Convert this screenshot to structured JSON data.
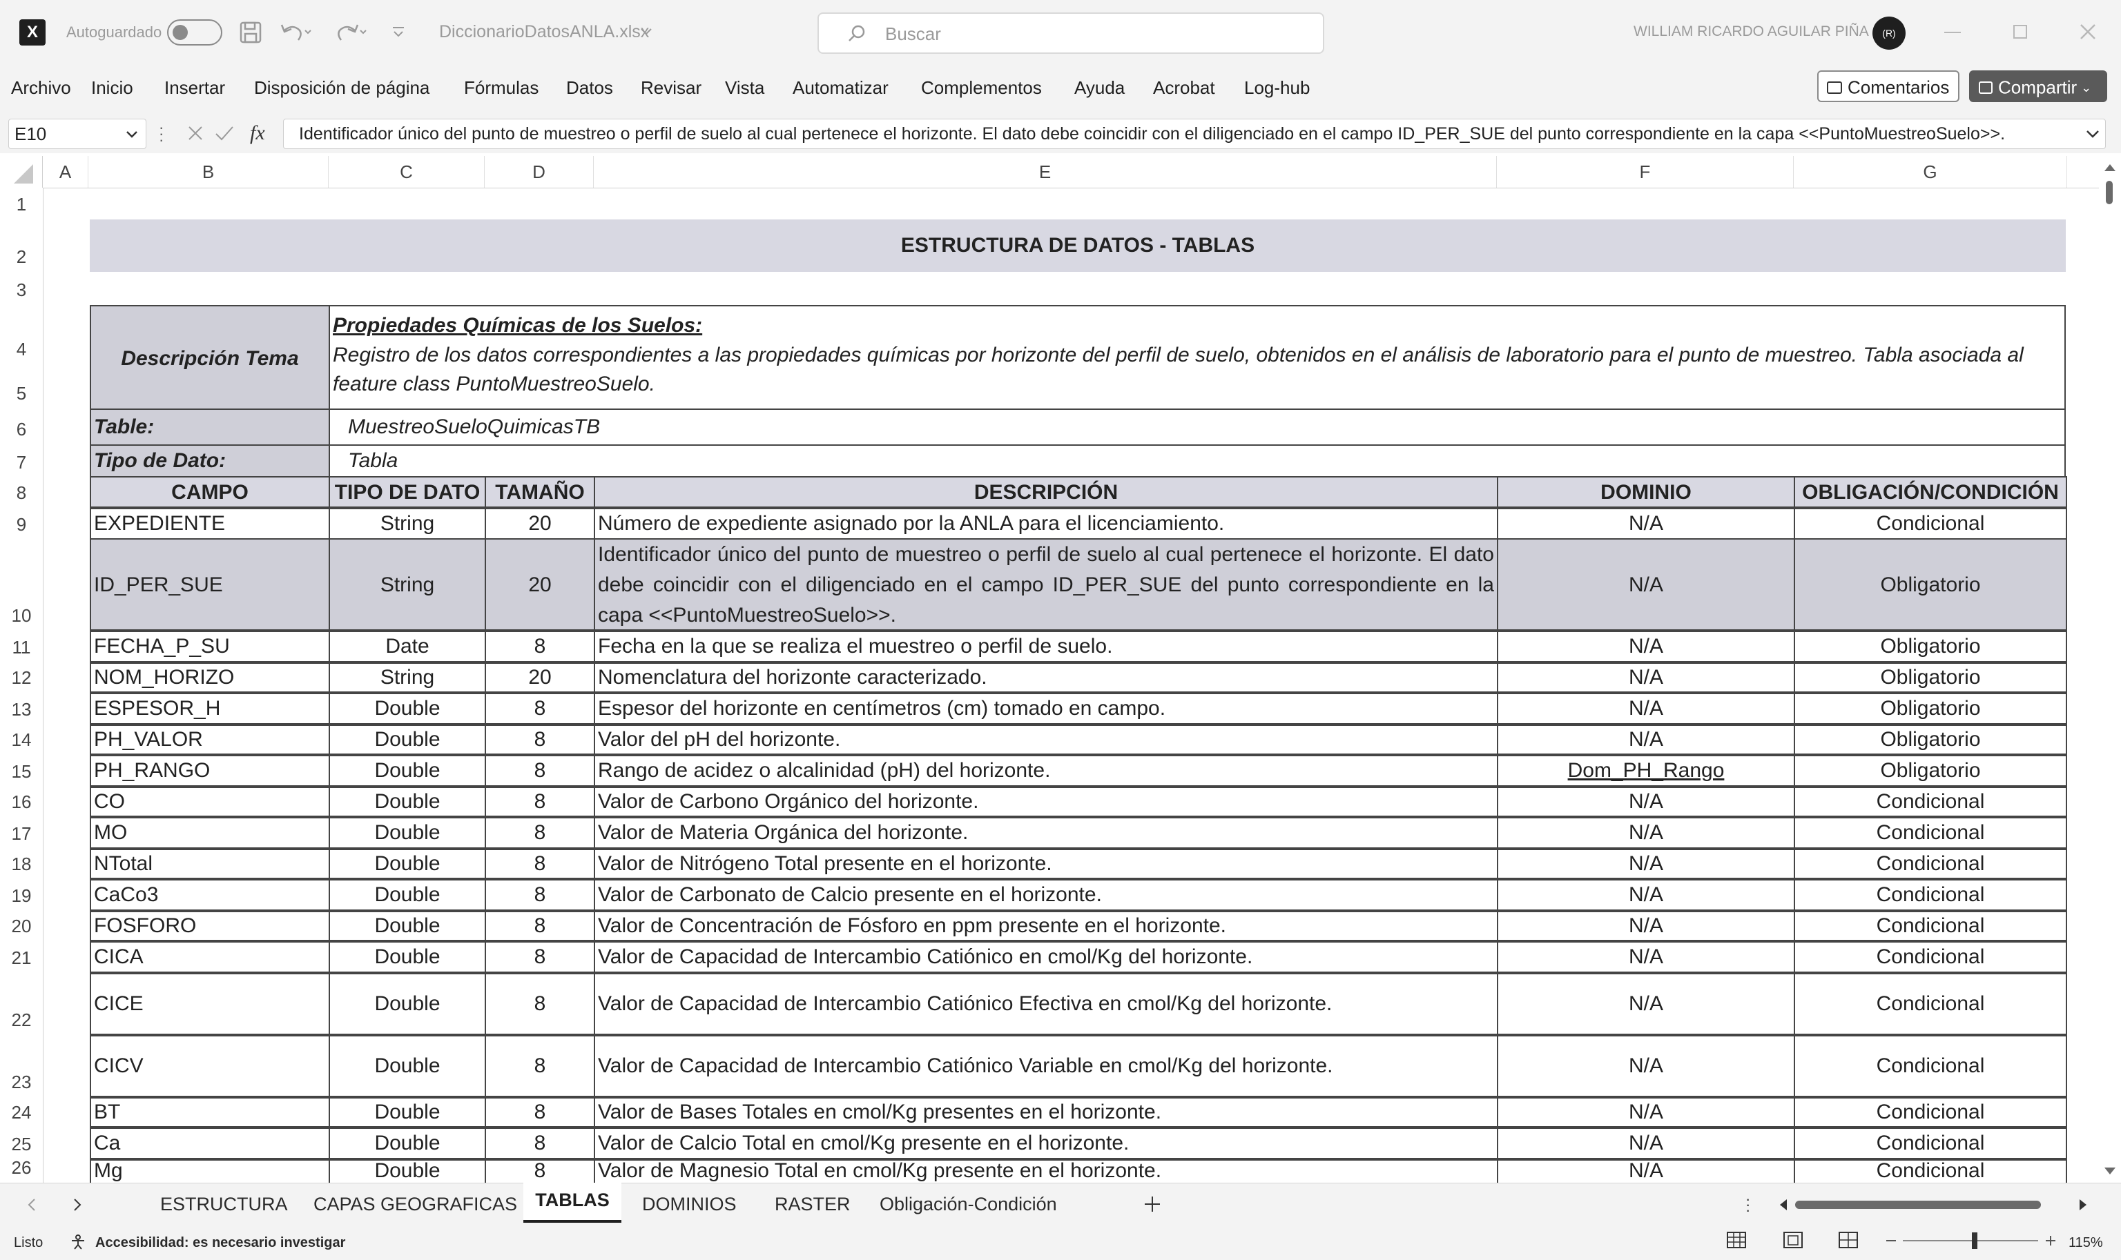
{
  "app": {
    "autosave_label": "Autoguardado",
    "file_name": "DiccionarioDatosANLA.xlsx",
    "search_placeholder": "Buscar",
    "user_name": "WILLIAM RICARDO AGUILAR PIÑA",
    "user_initials": "(R)"
  },
  "menu": [
    "Archivo",
    "Inicio",
    "Insertar",
    "Disposición de página",
    "Fórmulas",
    "Datos",
    "Revisar",
    "Vista",
    "Automatizar",
    "Complementos",
    "Ayuda",
    "Acrobat",
    "Log-hub"
  ],
  "ribbon_buttons": {
    "comments": "Comentarios",
    "share": "Compartir"
  },
  "formula_bar": {
    "name_box": "E10",
    "fx": "fx",
    "content": "Identificador único del punto de muestreo o perfil de suelo al cual pertenece el horizonte. El dato debe coincidir con el diligenciado en el campo ID_PER_SUE del punto correspondiente en la capa <<PuntoMuestreoSuelo>>."
  },
  "columns": [
    "A",
    "B",
    "C",
    "D",
    "E",
    "F",
    "G"
  ],
  "rows": [
    "1",
    "2",
    "3",
    "4",
    "5",
    "6",
    "7",
    "8",
    "9",
    "10",
    "11",
    "12",
    "13",
    "14",
    "15",
    "16",
    "17",
    "18",
    "19",
    "20",
    "21",
    "22",
    "23",
    "24",
    "25",
    "26"
  ],
  "sheet": {
    "title": "ESTRUCTURA DE DATOS - TABLAS",
    "desc_label": "Descripción Tema",
    "topic_title": "Propiedades Químicas de los Suelos:",
    "topic_description": "Registro de los datos correspondientes a las propiedades químicas por horizonte del perfil de suelo, obtenidos en el análisis de laboratorio para el punto de muestreo. Tabla asociada al feature class PuntoMuestreoSuelo.",
    "table_label": "Table:",
    "table_value": "MuestreoSueloQuimicasTB",
    "type_label": "Tipo de Dato:",
    "type_value": "Tabla",
    "headers": [
      "CAMPO",
      "TIPO DE DATO",
      "TAMAÑO",
      "DESCRIPCIÓN",
      "DOMINIO",
      "OBLIGACIÓN/CONDICIÓN"
    ],
    "records": [
      {
        "campo": "EXPEDIENTE",
        "tipo": "String",
        "tam": "20",
        "desc": "Número de expediente asignado por la ANLA para el licenciamiento.",
        "dom": "N/A",
        "obl": "Condicional"
      },
      {
        "campo": "ID_PER_SUE",
        "tipo": "String",
        "tam": "20",
        "desc": "Identificador único del punto de muestreo o perfil de suelo al cual pertenece el horizonte. El dato debe coincidir con el diligenciado en el campo ID_PER_SUE del punto correspondiente en la capa <<PuntoMuestreoSuelo>>.",
        "dom": "N/A",
        "obl": "Obligatorio"
      },
      {
        "campo": "FECHA_P_SU",
        "tipo": "Date",
        "tam": "8",
        "desc": "Fecha en la que se realiza el muestreo o perfil de suelo.",
        "dom": "N/A",
        "obl": "Obligatorio"
      },
      {
        "campo": "NOM_HORIZO",
        "tipo": "String",
        "tam": "20",
        "desc": "Nomenclatura del horizonte caracterizado.",
        "dom": "N/A",
        "obl": "Obligatorio"
      },
      {
        "campo": "ESPESOR_H",
        "tipo": "Double",
        "tam": "8",
        "desc": "Espesor del horizonte en centímetros (cm) tomado en campo.",
        "dom": "N/A",
        "obl": "Obligatorio"
      },
      {
        "campo": "PH_VALOR",
        "tipo": "Double",
        "tam": "8",
        "desc": "Valor del pH del horizonte.",
        "dom": "N/A",
        "obl": "Obligatorio"
      },
      {
        "campo": "PH_RANGO",
        "tipo": "Double",
        "tam": "8",
        "desc": "Rango de acidez o alcalinidad (pH) del horizonte.",
        "dom": "Dom_PH_Rango",
        "obl": "Obligatorio"
      },
      {
        "campo": "CO",
        "tipo": "Double",
        "tam": "8",
        "desc": "Valor de Carbono Orgánico del horizonte.",
        "dom": "N/A",
        "obl": "Condicional"
      },
      {
        "campo": "MO",
        "tipo": "Double",
        "tam": "8",
        "desc": "Valor de Materia Orgánica del horizonte.",
        "dom": "N/A",
        "obl": "Condicional"
      },
      {
        "campo": "NTotal",
        "tipo": "Double",
        "tam": "8",
        "desc": "Valor de Nitrógeno Total presente en el horizonte.",
        "dom": "N/A",
        "obl": "Condicional"
      },
      {
        "campo": "CaCo3",
        "tipo": "Double",
        "tam": "8",
        "desc": "Valor de Carbonato de Calcio presente en el horizonte.",
        "dom": "N/A",
        "obl": "Condicional"
      },
      {
        "campo": "FOSFORO",
        "tipo": "Double",
        "tam": "8",
        "desc": "Valor de Concentración de Fósforo en ppm presente en el horizonte.",
        "dom": "N/A",
        "obl": "Condicional"
      },
      {
        "campo": "CICA",
        "tipo": "Double",
        "tam": "8",
        "desc": "Valor de Capacidad de Intercambio Catiónico en cmol/Kg del horizonte.",
        "dom": "N/A",
        "obl": "Condicional"
      },
      {
        "campo": "CICE",
        "tipo": "Double",
        "tam": "8",
        "desc": "Valor de Capacidad de Intercambio Catiónico Efectiva en cmol/Kg del horizonte.",
        "dom": "N/A",
        "obl": "Condicional"
      },
      {
        "campo": "CICV",
        "tipo": "Double",
        "tam": "8",
        "desc": "Valor de Capacidad de Intercambio Catiónico Variable en cmol/Kg del horizonte.",
        "dom": "N/A",
        "obl": "Condicional"
      },
      {
        "campo": "BT",
        "tipo": "Double",
        "tam": "8",
        "desc": "Valor de Bases Totales en cmol/Kg presentes en el horizonte.",
        "dom": "N/A",
        "obl": "Condicional"
      },
      {
        "campo": "Ca",
        "tipo": "Double",
        "tam": "8",
        "desc": "Valor de Calcio Total en cmol/Kg presente en el horizonte.",
        "dom": "N/A",
        "obl": "Condicional"
      },
      {
        "campo": "Mg",
        "tipo": "Double",
        "tam": "8",
        "desc": "Valor de Magnesio Total en cmol/Kg presente en el horizonte.",
        "dom": "N/A",
        "obl": "Condicional"
      }
    ]
  },
  "tabs": [
    "ESTRUCTURA",
    "CAPAS GEOGRAFICAS",
    "TABLAS",
    "DOMINIOS",
    "RASTER",
    "Obligación-Condición"
  ],
  "active_tab": "TABLAS",
  "status": {
    "ready": "Listo",
    "accessibility": "Accesibilidad: es necesario investigar",
    "zoom": "115%"
  },
  "colors": {
    "chrome": "#f3f3f3",
    "header_fill": "#d8d8e2",
    "selected_fill": "#cfcfd8",
    "border": "#444444"
  }
}
